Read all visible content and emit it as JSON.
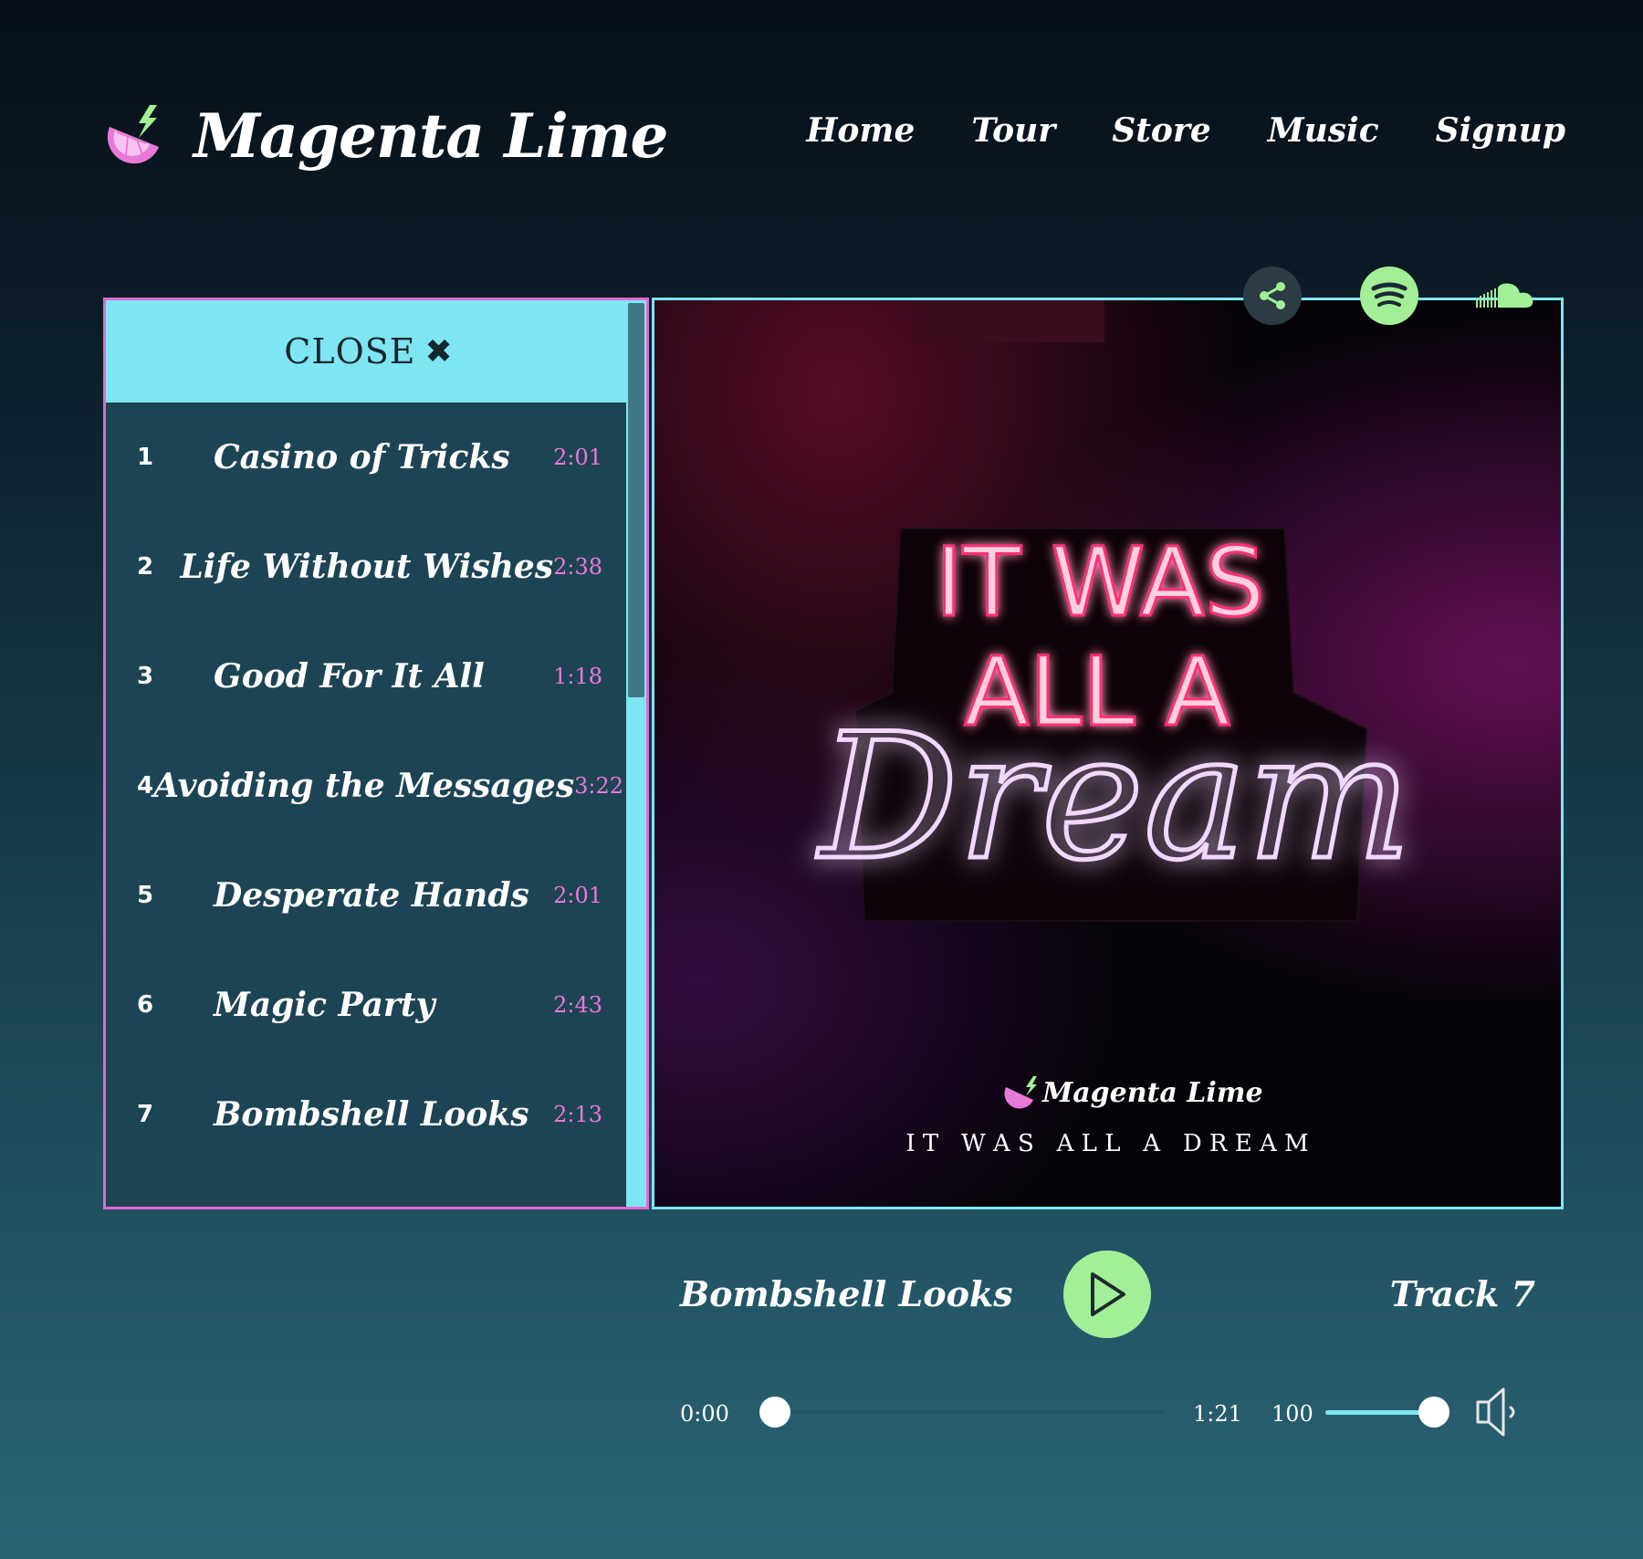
{
  "brand": {
    "name": "Magenta Lime",
    "logo_icon": "lime-lightning-logo-icon"
  },
  "nav": [
    "Home",
    "Tour",
    "Store",
    "Music",
    "Signup"
  ],
  "social": {
    "share_icon": "share-icon",
    "spotify_icon": "spotify-icon",
    "soundcloud_icon": "soundcloud-icon"
  },
  "playlist": {
    "close_label": "CLOSE",
    "close_icon": "close-x-icon",
    "tracks": [
      {
        "num": "1",
        "title": "Casino of Tricks",
        "duration": "2:01"
      },
      {
        "num": "2",
        "title": "Life Without Wishes",
        "duration": "2:38"
      },
      {
        "num": "3",
        "title": "Good For It All",
        "duration": "1:18"
      },
      {
        "num": "4",
        "title": "Avoiding the Messages",
        "duration": "3:22"
      },
      {
        "num": "5",
        "title": "Desperate Hands",
        "duration": "2:01"
      },
      {
        "num": "6",
        "title": "Magic Party",
        "duration": "2:43"
      },
      {
        "num": "7",
        "title": "Bombshell Looks",
        "duration": "2:13"
      }
    ]
  },
  "album": {
    "sign_line1": "IT WAS",
    "sign_line2": "ALL A",
    "sign_line3": "Dream",
    "brand": "Magenta Lime",
    "title": "I T   W A S   A L L   A   D R E A M"
  },
  "player": {
    "now_playing": "Bombshell Looks",
    "track_label": "Track 7",
    "play_icon": "play-icon",
    "time_current": "0:00",
    "time_total": "1:21",
    "progress": 0,
    "volume_label": "100",
    "volume": 1.0,
    "speaker_icon": "speaker-icon"
  },
  "colors": {
    "magenta": "#e06ad1",
    "cyan": "#7de6f2",
    "lime": "#a3ef98"
  }
}
